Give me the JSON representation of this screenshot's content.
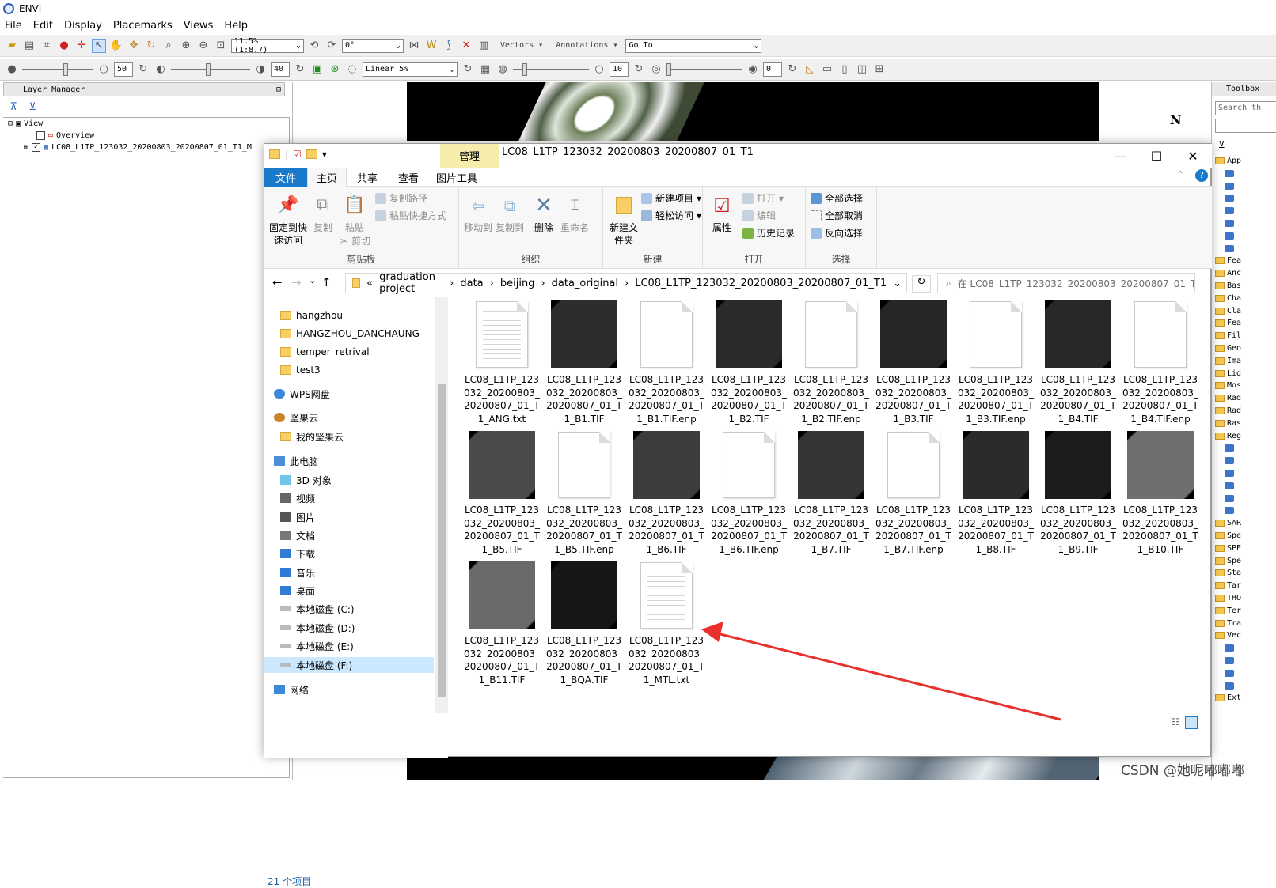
{
  "app": {
    "title": "ENVI"
  },
  "menu": [
    "File",
    "Edit",
    "Display",
    "Placemarks",
    "Views",
    "Help"
  ],
  "toolbar1": {
    "zoom_value": "11.5% (1:8.7)",
    "rotation_value": "0°",
    "vectors_label": "Vectors",
    "annotations_label": "Annotations",
    "goto_value": "Go To"
  },
  "toolbar2": {
    "brightness_value": "50",
    "contrast_value": "40",
    "stretch_value": "Linear 5%",
    "sharpen_value": "10",
    "transparency_value": "0"
  },
  "layer_manager": {
    "title": "Layer Manager",
    "view_label": "View",
    "overview_label": "Overview",
    "layer_label": "LC08_L1TP_123032_20200803_20200807_01_T1_M"
  },
  "toolbox": {
    "title": "Toolbox",
    "search_placeholder": "Search th",
    "items": [
      "App",
      "",
      "",
      "",
      "",
      "",
      "",
      "",
      "Fea",
      "Anc",
      "Bas",
      "Cha",
      "Cla",
      "Fea",
      "Fil",
      "Geo",
      "Ima",
      "Lid",
      "Mos",
      "Rad",
      "Rad",
      "Ras",
      "Reg",
      "",
      "",
      "",
      "",
      "",
      "",
      "SAR",
      "Spe",
      "SPE",
      "Spe",
      "Sta",
      "Tar",
      "THO",
      "Ter",
      "Tra",
      "Vec",
      "",
      "",
      "",
      "",
      "Ext"
    ]
  },
  "explorer": {
    "manage_tab": "管理",
    "window_title": "LC08_L1TP_123032_20200803_20200807_01_T1",
    "tabs": [
      "文件",
      "主页",
      "共享",
      "查看",
      "图片工具"
    ],
    "ribbon": {
      "clipboard": {
        "label": "剪贴板",
        "pin": "固定到快速访问",
        "copy": "复制",
        "paste": "粘贴",
        "copy_path": "复制路径",
        "paste_shortcut": "粘贴快捷方式",
        "cut": "剪切"
      },
      "organize": {
        "label": "组织",
        "move_to": "移动到",
        "copy_to": "复制到",
        "delete": "删除",
        "rename": "重命名"
      },
      "new": {
        "label": "新建",
        "new_folder": "新建文件夹",
        "new_item": "新建项目",
        "easy_access": "轻松访问"
      },
      "open": {
        "label": "打开",
        "properties": "属性",
        "open": "打开",
        "edit": "编辑",
        "history": "历史记录"
      },
      "select": {
        "label": "选择",
        "select_all": "全部选择",
        "select_none": "全部取消",
        "invert": "反向选择"
      }
    },
    "address": {
      "crumbs": [
        "graduation project",
        "data",
        "beijing",
        "data_original",
        "LC08_L1TP_123032_20200803_20200807_01_T1"
      ],
      "search_placeholder": "在 LC08_L1TP_123032_20200803_20200807_01_T1 ..."
    },
    "nav": {
      "items": [
        {
          "label": "hangzhou",
          "icon": "folder-icon"
        },
        {
          "label": "HANGZHOU_DANCHAUNG",
          "icon": "folder-icon"
        },
        {
          "label": "temper_retrival",
          "icon": "folder-icon"
        },
        {
          "label": "test3",
          "icon": "folder-icon"
        },
        {
          "label": "WPS网盘",
          "icon": "cloud-icon"
        },
        {
          "label": "坚果云",
          "icon": "nut-icon"
        },
        {
          "label": "我的坚果云",
          "icon": "folder-icon"
        },
        {
          "label": "此电脑",
          "icon": "computer-icon"
        },
        {
          "label": "3D 对象",
          "icon": "cube-icon"
        },
        {
          "label": "视频",
          "icon": "video-icon"
        },
        {
          "label": "图片",
          "icon": "picture-icon"
        },
        {
          "label": "文档",
          "icon": "document-icon"
        },
        {
          "label": "下载",
          "icon": "download-icon"
        },
        {
          "label": "音乐",
          "icon": "music-icon"
        },
        {
          "label": "桌面",
          "icon": "desktop-icon"
        },
        {
          "label": "本地磁盘 (C:)",
          "icon": "drive-icon"
        },
        {
          "label": "本地磁盘 (D:)",
          "icon": "drive-icon"
        },
        {
          "label": "本地磁盘 (E:)",
          "icon": "drive-icon"
        },
        {
          "label": "本地磁盘 (F:)",
          "icon": "drive-icon"
        },
        {
          "label": "网络",
          "icon": "network-icon"
        }
      ]
    },
    "files": [
      {
        "name": "LC08_L1TP_123032_20200803_20200807_01_T1_ANG.txt",
        "kind": "text"
      },
      {
        "name": "LC08_L1TP_123032_20200803_20200807_01_T1_B1.TIF",
        "kind": "image"
      },
      {
        "name": "LC08_L1TP_123032_20200803_20200807_01_T1_B1.TIF.enp",
        "kind": "blank"
      },
      {
        "name": "LC08_L1TP_123032_20200803_20200807_01_T1_B2.TIF",
        "kind": "image"
      },
      {
        "name": "LC08_L1TP_123032_20200803_20200807_01_T1_B2.TIF.enp",
        "kind": "blank"
      },
      {
        "name": "LC08_L1TP_123032_20200803_20200807_01_T1_B3.TIF",
        "kind": "image"
      },
      {
        "name": "LC08_L1TP_123032_20200803_20200807_01_T1_B3.TIF.enp",
        "kind": "blank"
      },
      {
        "name": "LC08_L1TP_123032_20200803_20200807_01_T1_B4.TIF",
        "kind": "image"
      },
      {
        "name": "LC08_L1TP_123032_20200803_20200807_01_T1_B4.TIF.enp",
        "kind": "blank"
      },
      {
        "name": "LC08_L1TP_123032_20200803_20200807_01_T1_B5.TIF",
        "kind": "image"
      },
      {
        "name": "LC08_L1TP_123032_20200803_20200807_01_T1_B5.TIF.enp",
        "kind": "blank"
      },
      {
        "name": "LC08_L1TP_123032_20200803_20200807_01_T1_B6.TIF",
        "kind": "image"
      },
      {
        "name": "LC08_L1TP_123032_20200803_20200807_01_T1_B6.TIF.enp",
        "kind": "blank"
      },
      {
        "name": "LC08_L1TP_123032_20200803_20200807_01_T1_B7.TIF",
        "kind": "image"
      },
      {
        "name": "LC08_L1TP_123032_20200803_20200807_01_T1_B7.TIF.enp",
        "kind": "blank"
      },
      {
        "name": "LC08_L1TP_123032_20200803_20200807_01_T1_B8.TIF",
        "kind": "image"
      },
      {
        "name": "LC08_L1TP_123032_20200803_20200807_01_T1_B9.TIF",
        "kind": "image"
      },
      {
        "name": "LC08_L1TP_123032_20200803_20200807_01_T1_B10.TIF",
        "kind": "image"
      },
      {
        "name": "LC08_L1TP_123032_20200803_20200807_01_T1_B11.TIF",
        "kind": "image"
      },
      {
        "name": "LC08_L1TP_123032_20200803_20200807_01_T1_BQA.TIF",
        "kind": "image"
      },
      {
        "name": "LC08_L1TP_123032_20200803_20200807_01_T1_MTL.txt",
        "kind": "text"
      }
    ],
    "status": "21 个项目"
  },
  "colors": {
    "accent": "#1979ca",
    "manage_tab": "#f6edac",
    "arrow": "#e8312f"
  },
  "watermark": "CSDN @她呢嘟嘟嘟"
}
